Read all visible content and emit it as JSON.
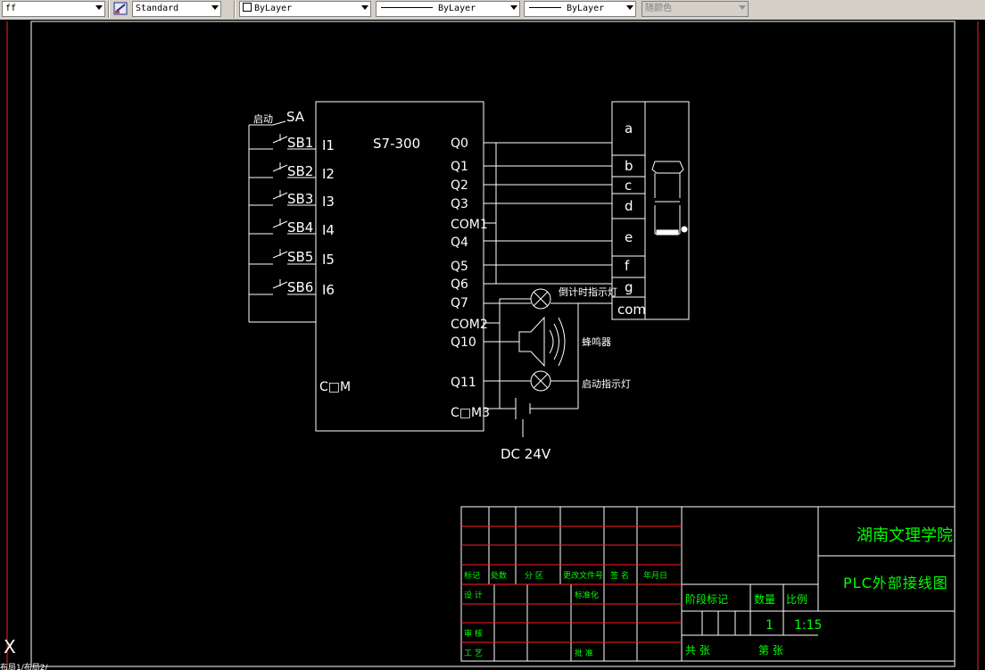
{
  "toolbar": {
    "layer_value": "ff",
    "text_style_value": "Standard",
    "color_value": "ByLayer",
    "linetype_value": "ByLayer",
    "lineweight_value": "ByLayer",
    "plotstyle_value": "随颜色"
  },
  "drawing": {
    "plc_title": "S7-300",
    "start_label": "启动",
    "sa_label": "SA",
    "buttons": [
      "SB1",
      "SB2",
      "SB3",
      "SB4",
      "SB5",
      "SB6"
    ],
    "inputs": [
      "I1",
      "I2",
      "I3",
      "I4",
      "I5",
      "I6"
    ],
    "input_com": "C□M",
    "outputs": [
      "Q0",
      "Q1",
      "Q2",
      "Q3",
      "COM1",
      "Q4",
      "Q5",
      "Q6",
      "Q7",
      "COM2",
      "Q10",
      "Q11",
      "C□M3"
    ],
    "segments": [
      "a",
      "b",
      "c",
      "d",
      "e",
      "f",
      "g",
      "com"
    ],
    "countdown_lamp": "倒计时指示灯",
    "buzzer": "蜂鸣器",
    "start_lamp": "启动指示灯",
    "power": "DC 24V"
  },
  "title_block": {
    "school": "湖南文理学院",
    "drawing_title": "PLC外部接线图",
    "row_labels": [
      "标记",
      "处数",
      "分 区",
      "更改文件号",
      "签 名",
      "年月日"
    ],
    "design": "设 计",
    "standard": "标准化",
    "review": "审 核",
    "process": "工 艺",
    "approve": "批 准",
    "stage_mark": "阶段标记",
    "weight": "数量",
    "scale": "比例",
    "quantity_value": "1",
    "scale_value": "1:15",
    "total": "共 张",
    "sheet": "第 张"
  },
  "colors": {
    "background": "#000000",
    "line": "#ffffff",
    "title_text": "#00ff00",
    "block_rule": "#ff0000",
    "border": "#ff0000"
  },
  "ucs_label": "X",
  "status_text": "布局1/布局2/"
}
